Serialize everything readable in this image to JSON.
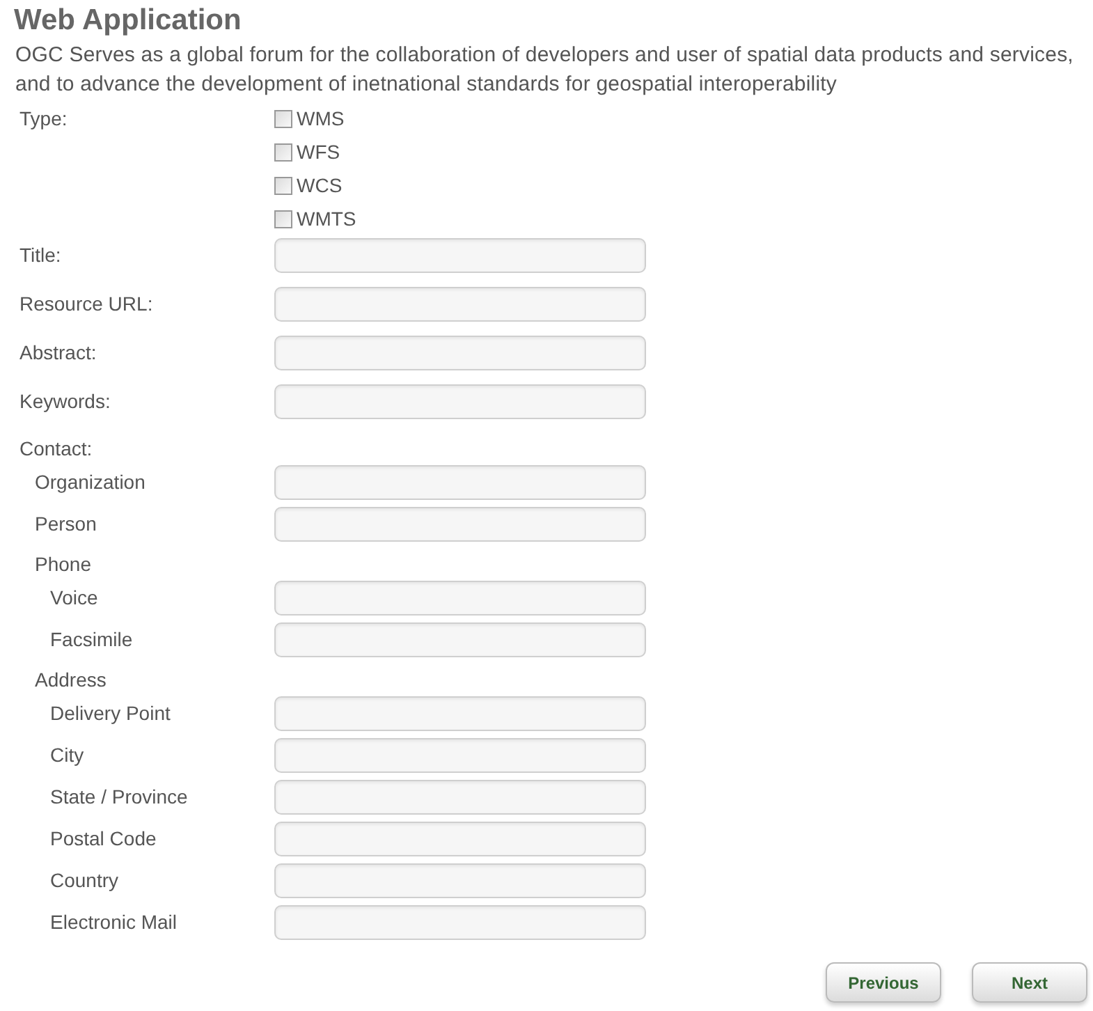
{
  "title": "Web Application",
  "description": "OGC Serves as a global forum for the collaboration of developers and user of spatial data products and services, and to advance the development of inetnational standards for geospatial interoperability",
  "type": {
    "label": "Type:",
    "options": [
      {
        "label": "WMS",
        "checked": false
      },
      {
        "label": "WFS",
        "checked": false
      },
      {
        "label": "WCS",
        "checked": false
      },
      {
        "label": "WMTS",
        "checked": false
      }
    ]
  },
  "fields": [
    {
      "kind": "field",
      "label": "Title:"
    },
    {
      "kind": "field",
      "label": "Resource URL:"
    },
    {
      "kind": "field",
      "label": "Abstract:"
    },
    {
      "kind": "field",
      "label": "Keywords:"
    },
    {
      "kind": "heading",
      "label": "Contact:",
      "children": [
        {
          "kind": "field",
          "label": "Organization"
        },
        {
          "kind": "field",
          "label": "Person"
        },
        {
          "kind": "heading",
          "label": "Phone",
          "children": [
            {
              "kind": "field",
              "label": "Voice"
            },
            {
              "kind": "field",
              "label": "Facsimile"
            }
          ]
        },
        {
          "kind": "heading",
          "label": "Address",
          "children": [
            {
              "kind": "field",
              "label": "Delivery Point"
            },
            {
              "kind": "field",
              "label": "City"
            },
            {
              "kind": "field",
              "label": "State / Province"
            },
            {
              "kind": "field",
              "label": "Postal Code"
            },
            {
              "kind": "field",
              "label": "Country"
            },
            {
              "kind": "field",
              "label": "Electronic Mail"
            }
          ]
        }
      ]
    }
  ],
  "buttons": [
    "Previous",
    "Next"
  ]
}
